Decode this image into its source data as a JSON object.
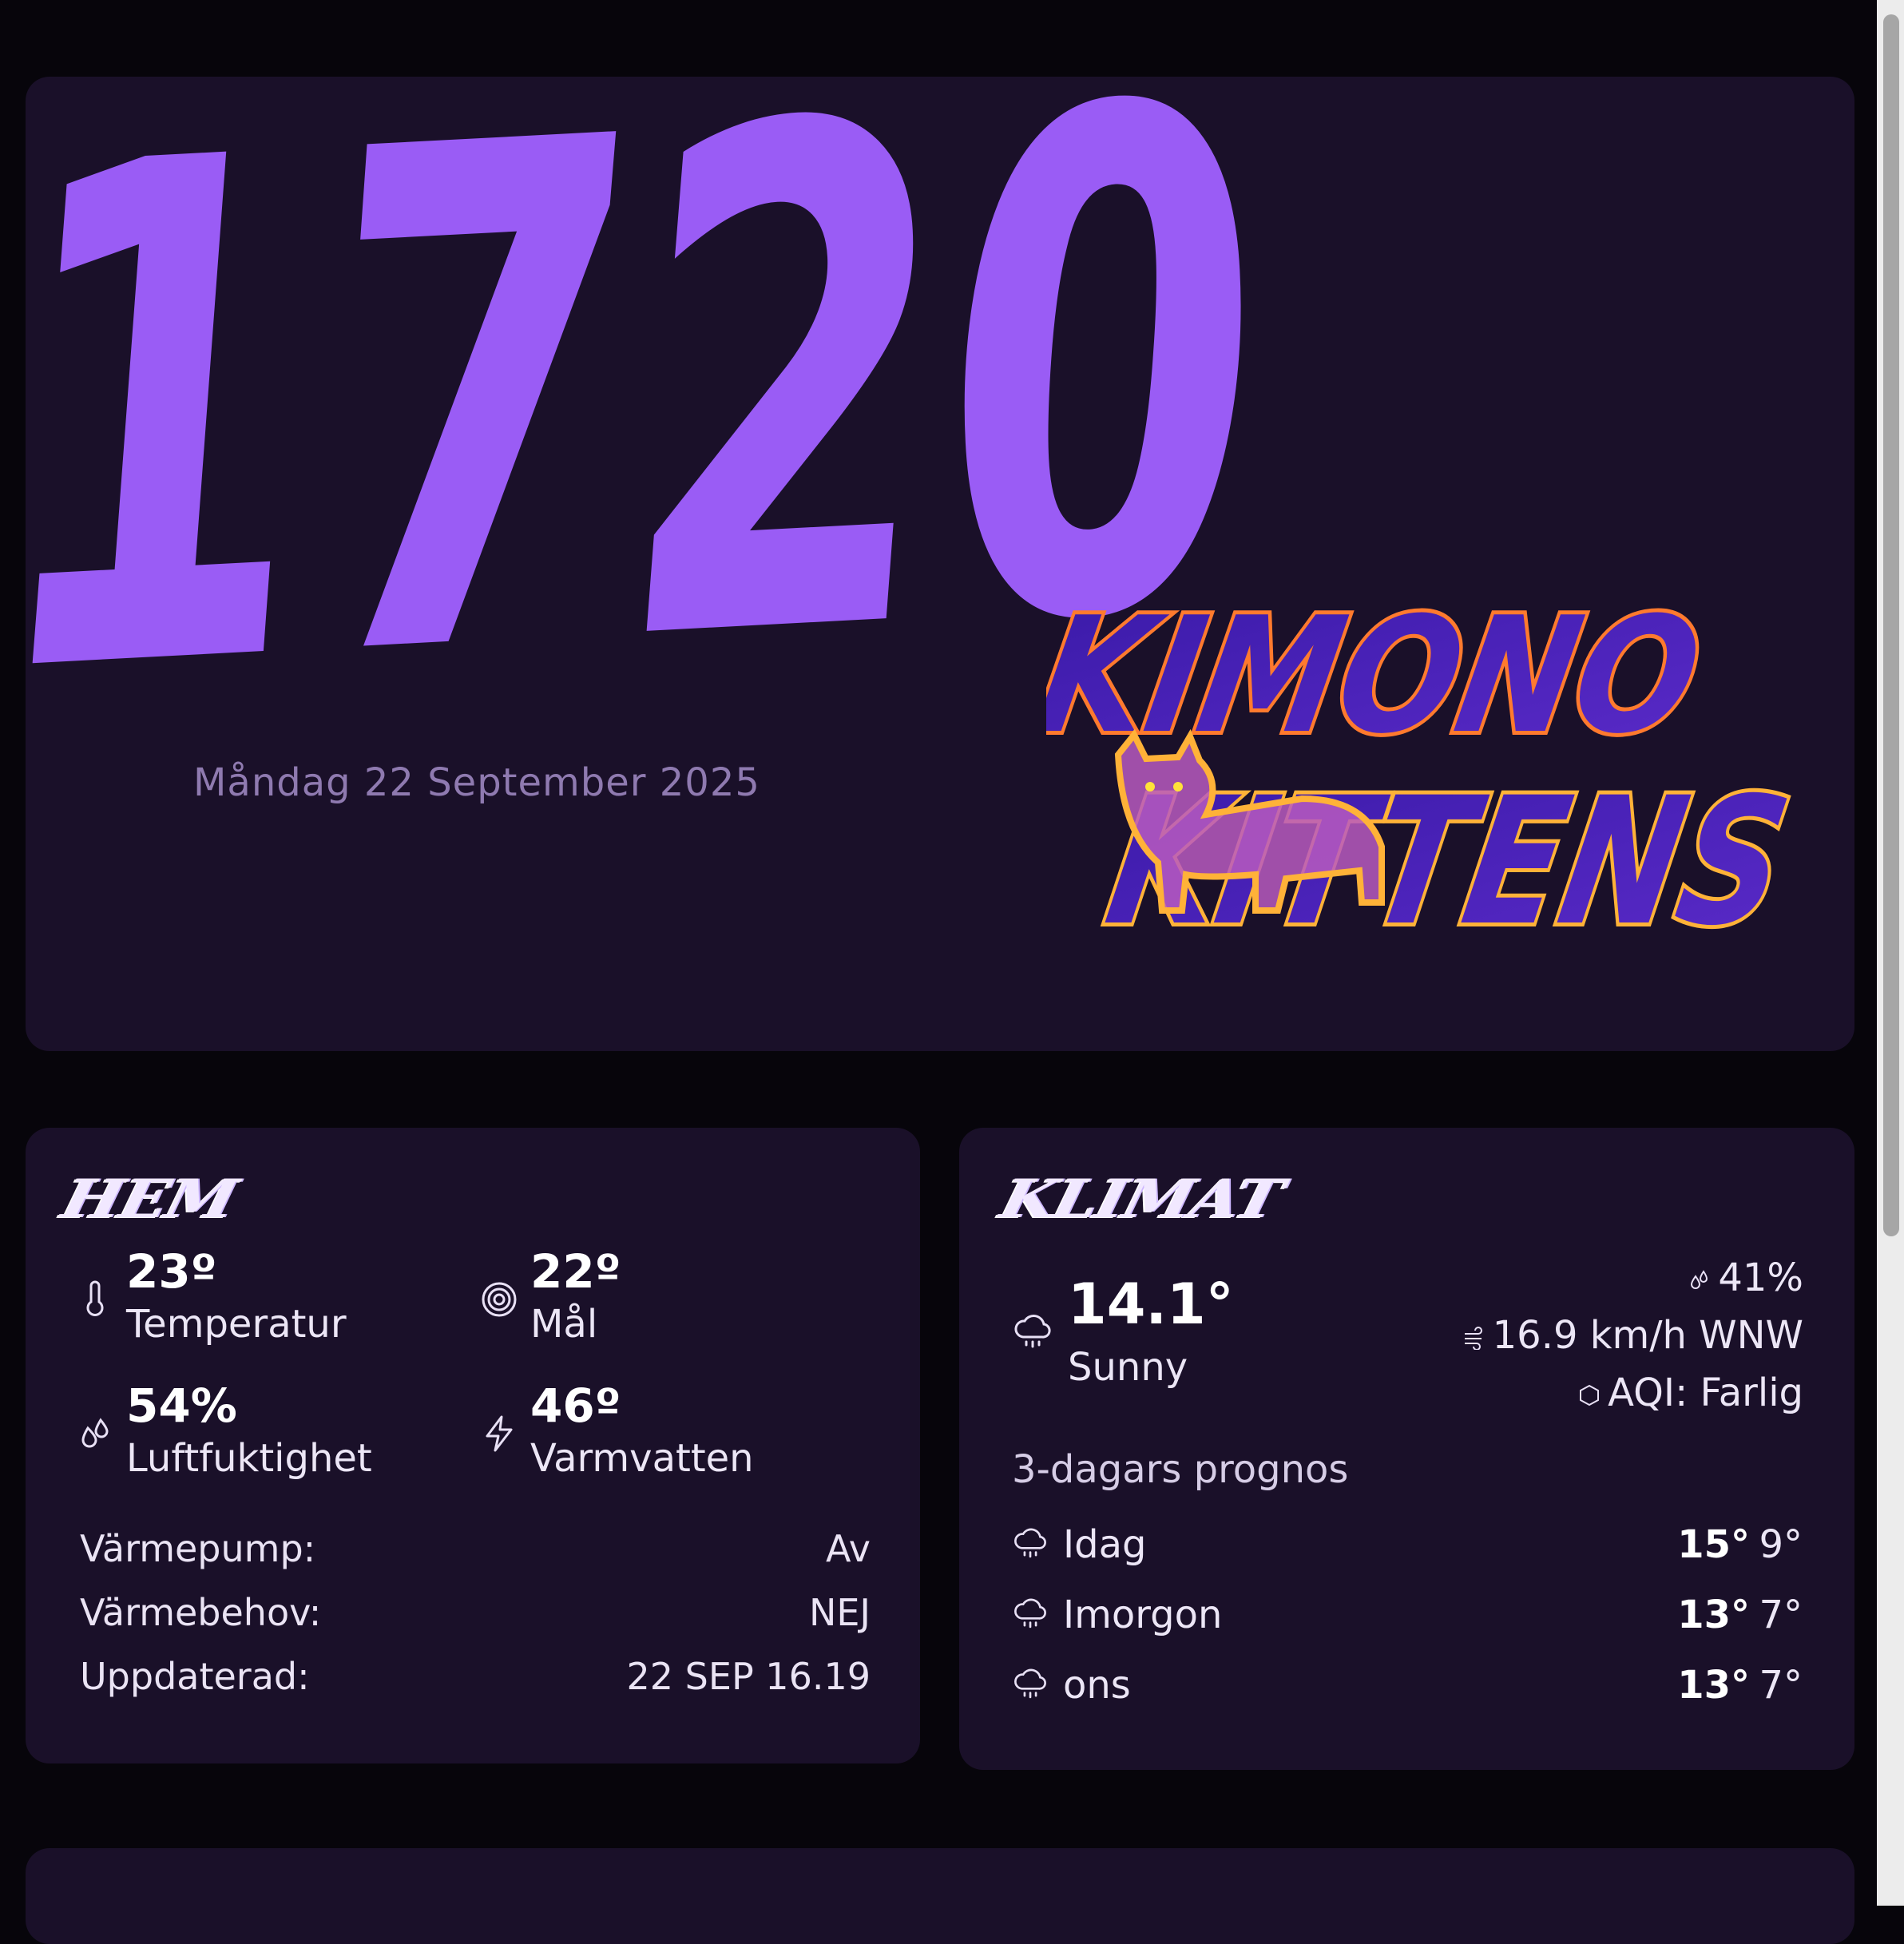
{
  "clock": {
    "time": "1720",
    "date": "Måndag 22 September 2025"
  },
  "logo": {
    "line1": "KIMONO",
    "line2": "KITTENS"
  },
  "hem": {
    "title": "HEM",
    "temperature": {
      "value": "23º",
      "label": "Temperatur",
      "icon": "thermometer-icon"
    },
    "target": {
      "value": "22º",
      "label": "Mål",
      "icon": "target-icon"
    },
    "humidity": {
      "value": "54%",
      "label": "Luftfuktighet",
      "icon": "droplets-icon"
    },
    "hotwater": {
      "value": "46º",
      "label": "Varmvatten",
      "icon": "lightning-icon"
    },
    "rows": [
      {
        "key": "Värmepump:",
        "value": "Av"
      },
      {
        "key": "Värmebehov:",
        "value": "NEJ"
      },
      {
        "key": "Uppdaterad:",
        "value": "22 SEP 16.19"
      }
    ]
  },
  "klimat": {
    "title": "KLIMAT",
    "temp": "14.1°",
    "condition": "Sunny",
    "humidity": "41%",
    "wind": "16.9 km/h WNW",
    "aqi": "AQI: Farlig",
    "forecast_title": "3-dagars prognos",
    "forecast": [
      {
        "day": "Idag",
        "high": "15°",
        "low": "9°"
      },
      {
        "day": "Imorgon",
        "high": "13°",
        "low": "7°"
      },
      {
        "day": "ons",
        "high": "13°",
        "low": "7°"
      }
    ]
  },
  "colors": {
    "accent": "#9a5cf5",
    "card": "#1a1029",
    "background": "#07050b",
    "logo_outline": "#ffb238"
  }
}
